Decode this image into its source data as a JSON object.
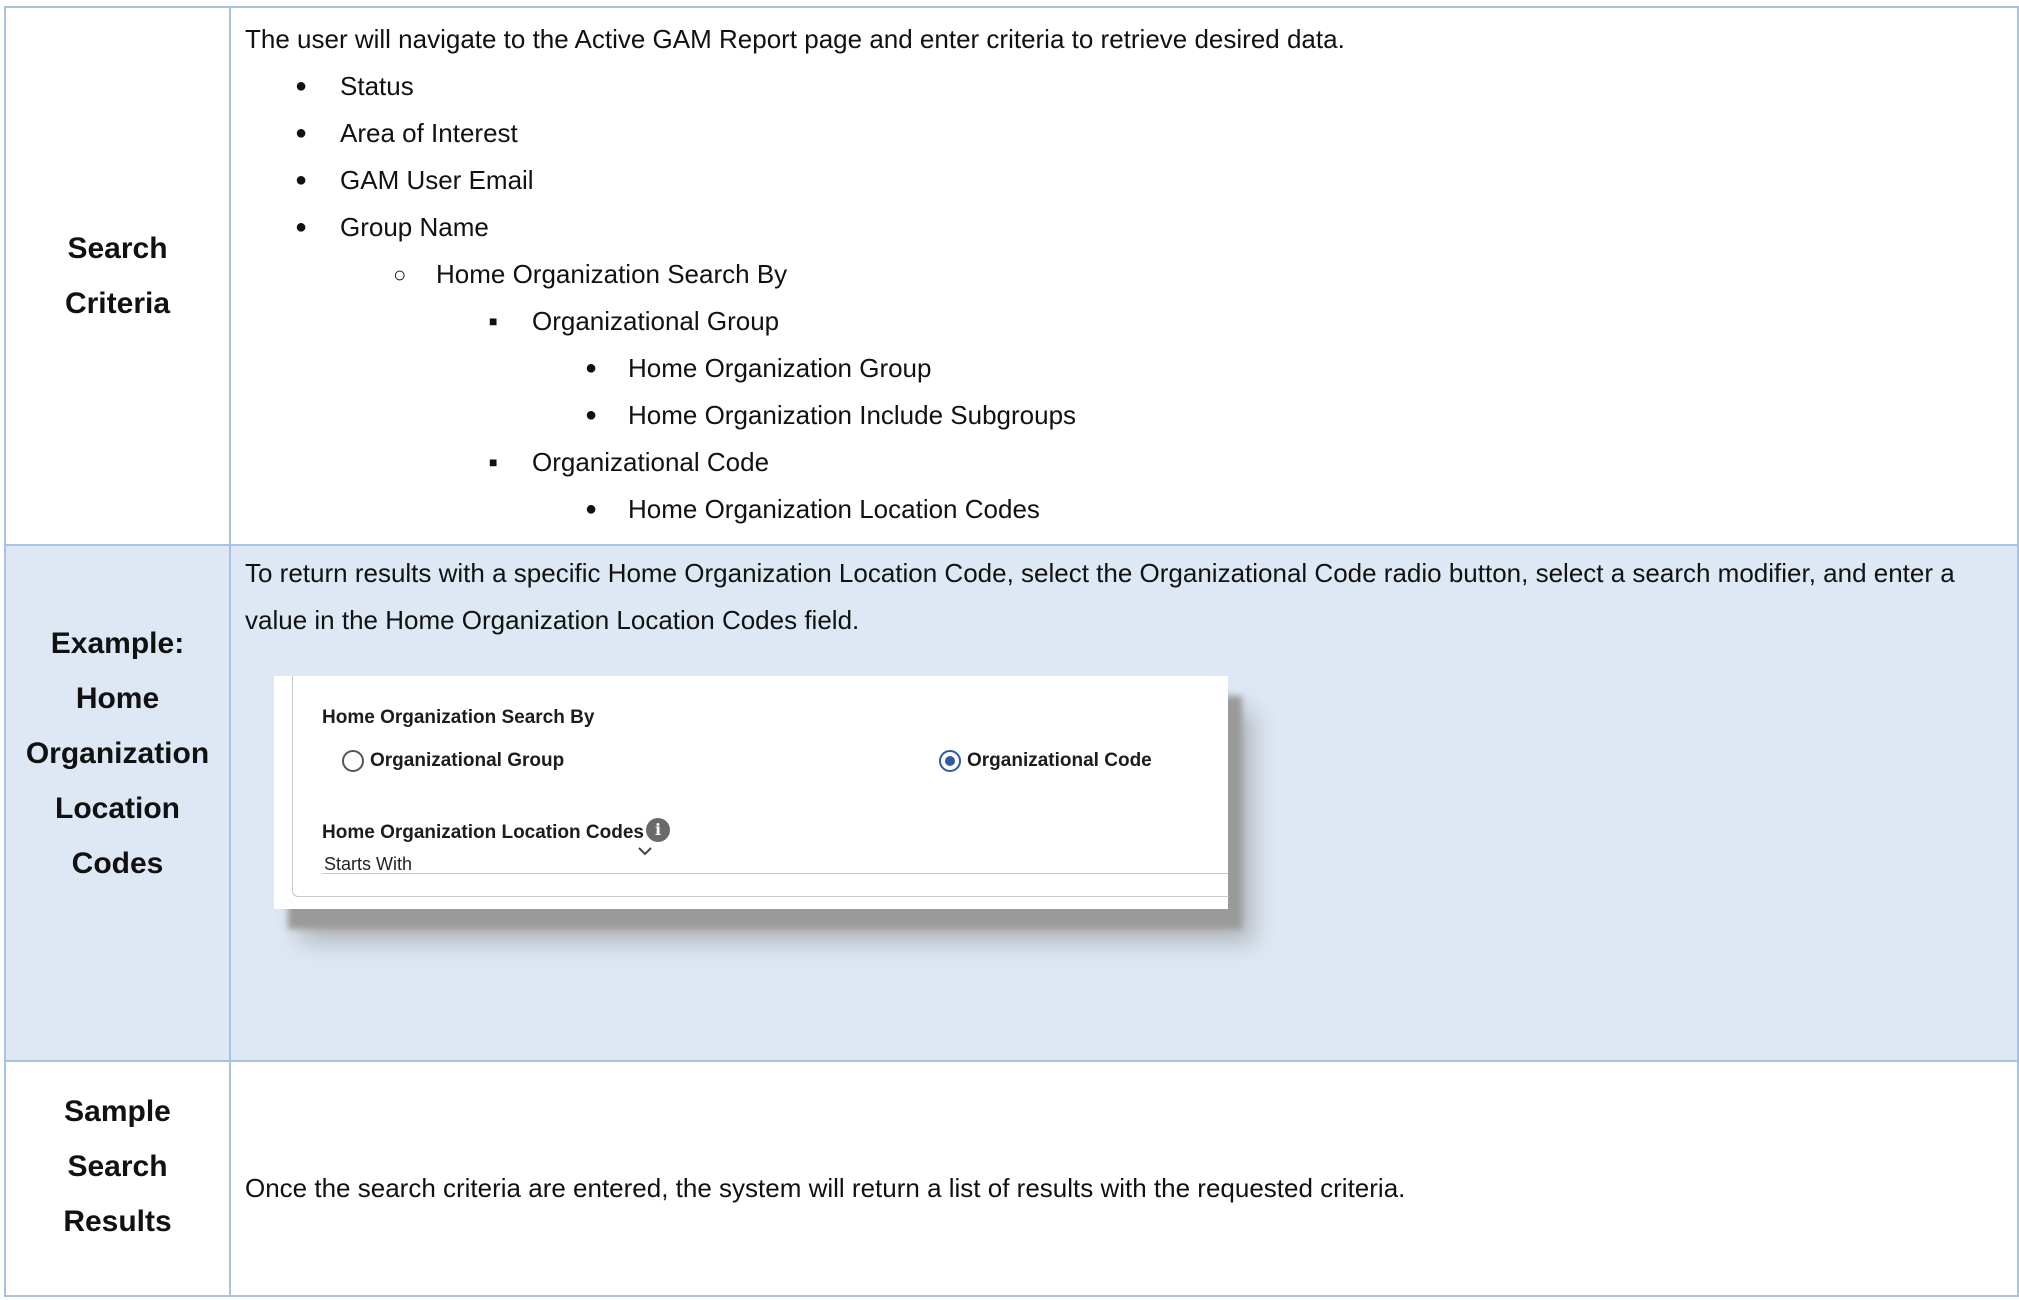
{
  "rows": [
    {
      "label": "Search Criteria",
      "intro": "The user will navigate to the Active GAM Report page and enter criteria to retrieve desired data.",
      "items": [
        "Status",
        "Area of Interest",
        "GAM User Email",
        "Group Name",
        "Home Organization Search By",
        "Organizational Group",
        "Home Organization Group",
        "Home Organization Include Subgroups",
        "Organizational Code",
        "Home Organization Location Codes"
      ]
    },
    {
      "label": "Example: Home Organization Location Codes",
      "intro": "To return results with a specific Home Organization Location Code, select the Organizational Code radio button, select a search modifier, and enter a value in the Home Organization Location Codes field.",
      "screenshot": {
        "title": "Home Organization Search By",
        "radio_group_label": "Organizational Group",
        "radio_code_label": "Organizational Code",
        "selected": "Organizational Code",
        "codes_label": "Home Organization Location Codes",
        "info_icon": "info-icon",
        "modifier_value": "Starts With"
      }
    },
    {
      "label": "Sample Search Results",
      "text": "Once the search criteria are entered, the system will return a list of results with the requested criteria."
    }
  ],
  "colors": {
    "border": "#a8c2e2",
    "row_highlight": "#dde8f4",
    "radio_selected": "#3557a8"
  }
}
